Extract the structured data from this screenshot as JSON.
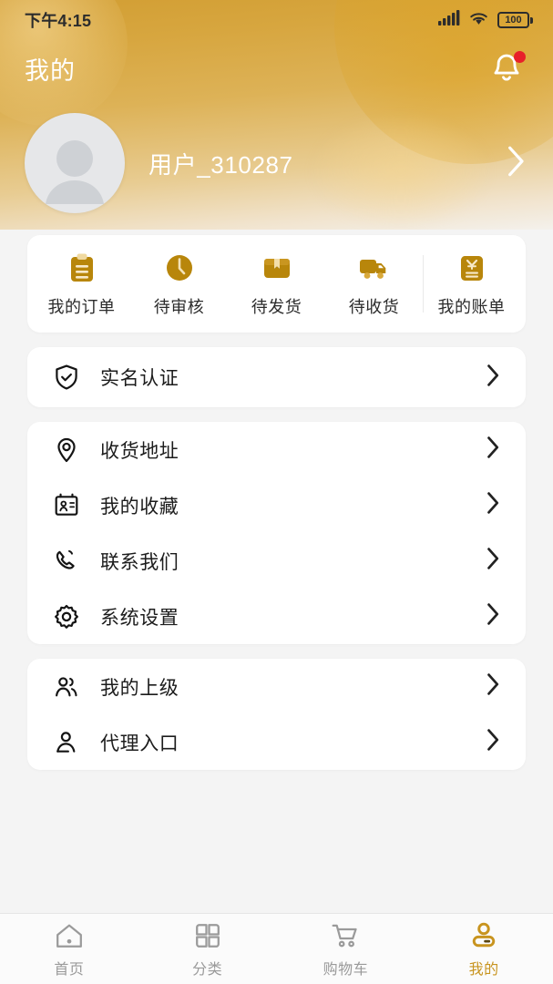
{
  "statusbar": {
    "time": "下午4:15",
    "battery_level": "100",
    "signal_icon": "signal-bars-icon",
    "wifi_icon": "wifi-icon",
    "battery_icon": "battery-icon"
  },
  "header": {
    "title": "我的",
    "notification_icon": "bell-icon",
    "has_notification_dot": true,
    "gradient_from": "#d29e33",
    "gradient_to": "#f4f1ec"
  },
  "profile": {
    "username": "用户_310287",
    "avatar_icon": "avatar-placeholder-icon",
    "chevron_icon": "chevron-right-icon"
  },
  "orders": {
    "items": [
      {
        "label": "我的订单",
        "icon": "clipboard-icon"
      },
      {
        "label": "待审核",
        "icon": "clock-icon"
      },
      {
        "label": "待发货",
        "icon": "package-box-icon"
      },
      {
        "label": "待收货",
        "icon": "delivery-truck-icon"
      },
      {
        "label": "我的账单",
        "icon": "bill-yuan-icon",
        "separated": true
      }
    ],
    "accent_color": "#b8860b"
  },
  "menu_groups": [
    {
      "id": "verify",
      "items": [
        {
          "label": "实名认证",
          "icon": "shield-check-icon"
        }
      ]
    },
    {
      "id": "general",
      "items": [
        {
          "label": "收货地址",
          "icon": "location-pin-icon"
        },
        {
          "label": "我的收藏",
          "icon": "id-card-icon"
        },
        {
          "label": "联系我们",
          "icon": "phone-icon"
        },
        {
          "label": "系统设置",
          "icon": "gear-icon"
        }
      ]
    },
    {
      "id": "agency",
      "items": [
        {
          "label": "我的上级",
          "icon": "users-icon"
        },
        {
          "label": "代理入口",
          "icon": "user-icon"
        }
      ]
    }
  ],
  "tabbar": {
    "active_color": "#c8941f",
    "inactive_color": "#9a9a9a",
    "tabs": [
      {
        "label": "首页",
        "icon": "home-icon",
        "active": false
      },
      {
        "label": "分类",
        "icon": "grid-icon",
        "active": false
      },
      {
        "label": "购物车",
        "icon": "cart-icon",
        "active": false
      },
      {
        "label": "我的",
        "icon": "person-icon",
        "active": true
      }
    ]
  }
}
